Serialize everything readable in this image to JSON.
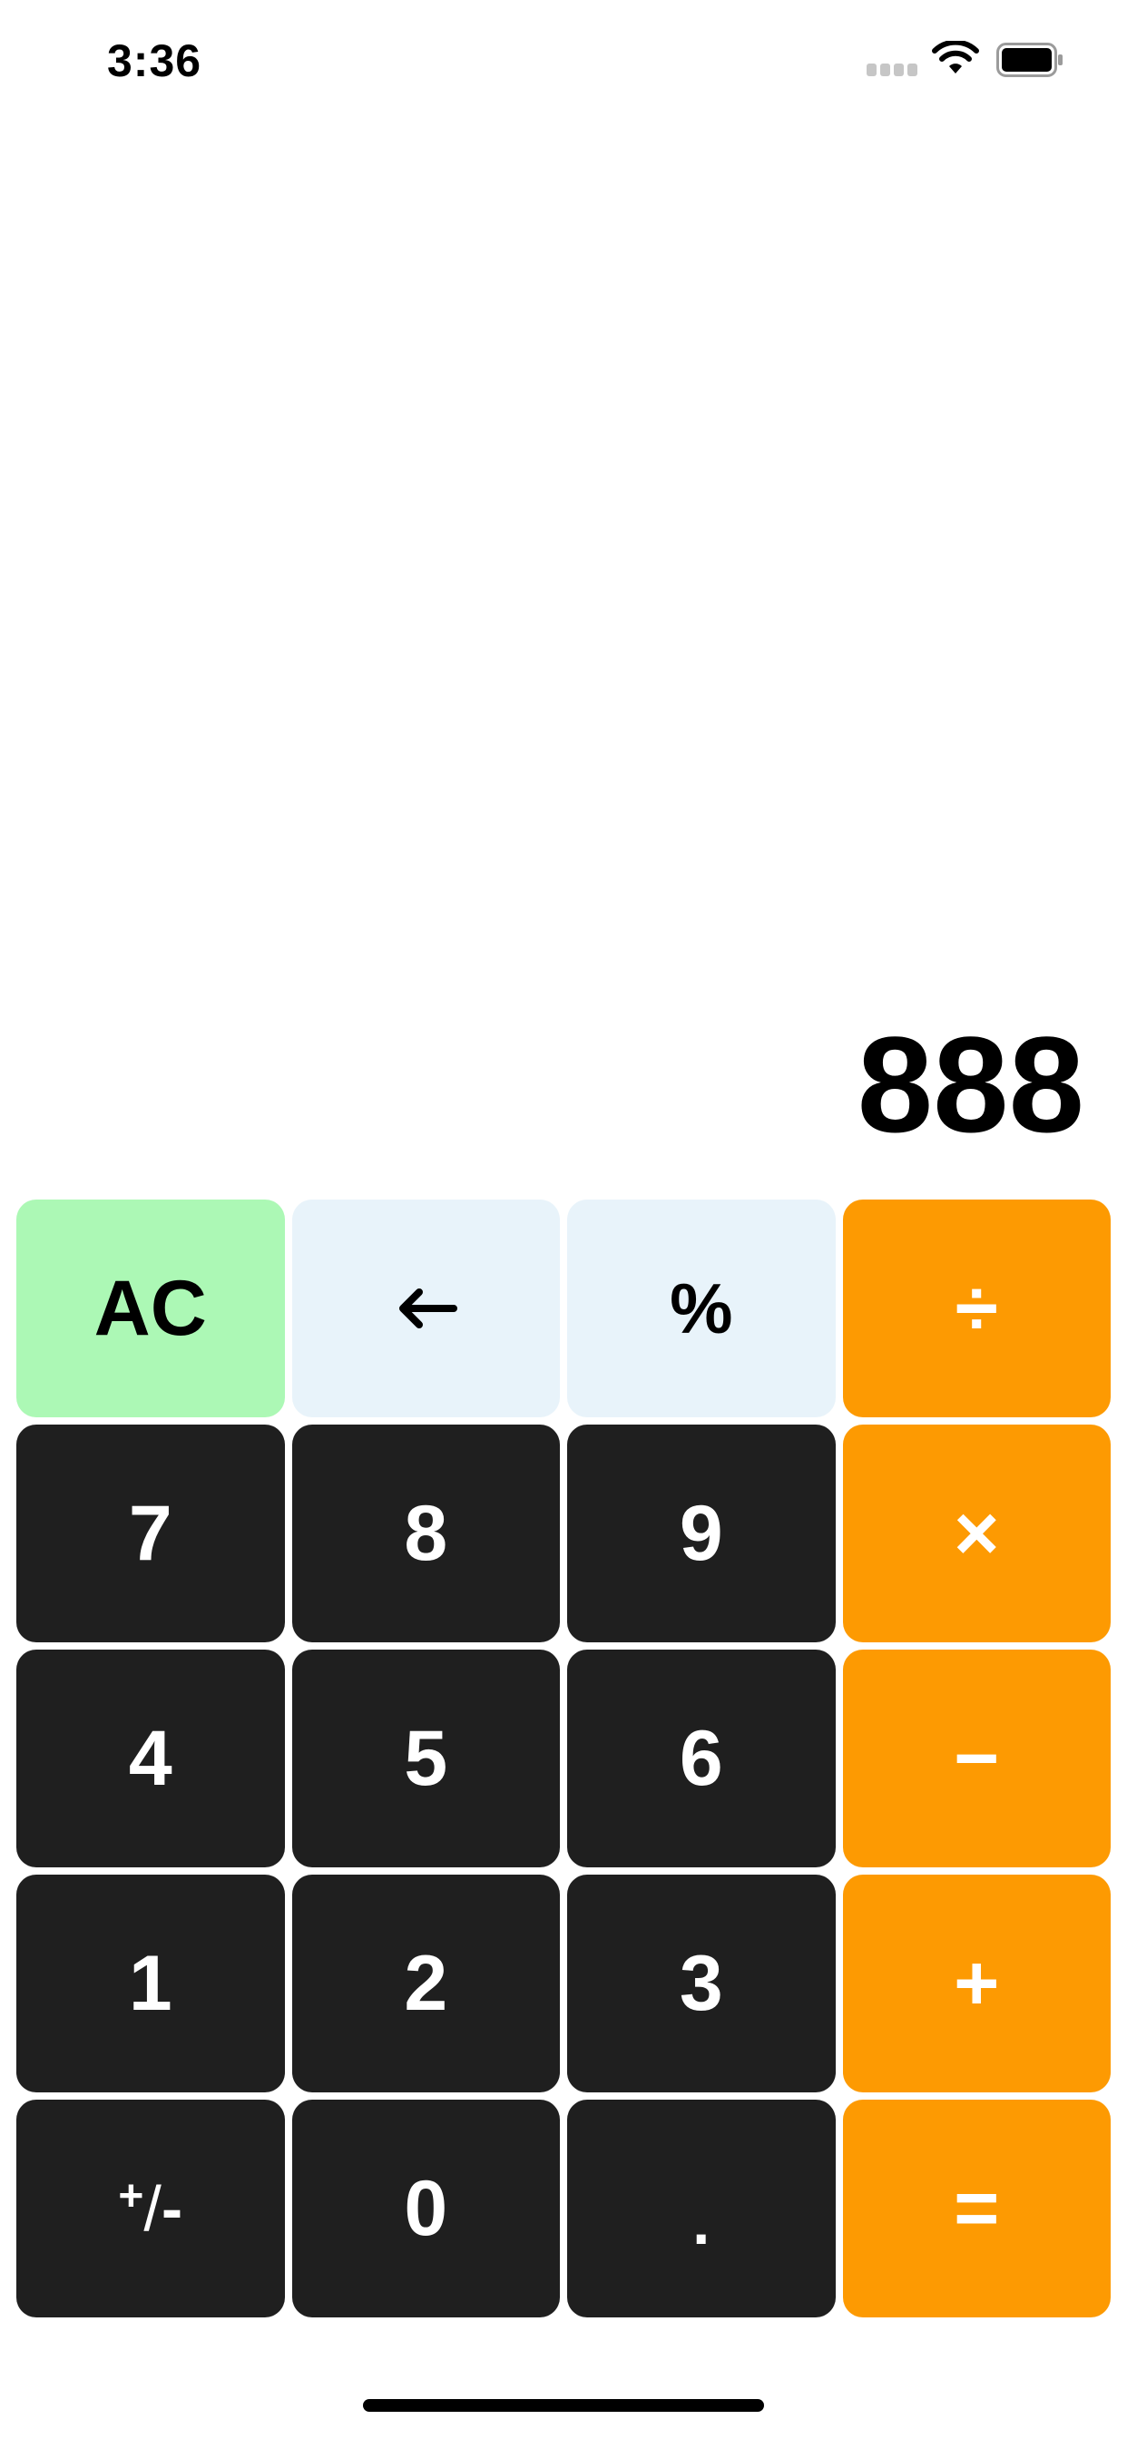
{
  "status_bar": {
    "time": "3:36",
    "signal_icon": "cellular-signal-icon",
    "wifi_icon": "wifi-icon",
    "battery_icon": "battery-icon"
  },
  "display": {
    "value": "888"
  },
  "keys": {
    "clear": "AC",
    "backspace": "←",
    "percent": "%",
    "divide": "÷",
    "seven": "7",
    "eight": "8",
    "nine": "9",
    "multiply": "×",
    "four": "4",
    "five": "5",
    "six": "6",
    "subtract": "−",
    "one": "1",
    "two": "2",
    "three": "3",
    "add": "+",
    "plus_minus_plus": "+",
    "plus_minus_slash": "/",
    "plus_minus_minus": "-",
    "zero": "0",
    "decimal": ".",
    "equals": "="
  },
  "colors": {
    "clear_key": "#acf8b5",
    "function_key": "#e8f3fa",
    "operator_key": "#fd9a02",
    "digit_key": "#1f1f1f"
  }
}
